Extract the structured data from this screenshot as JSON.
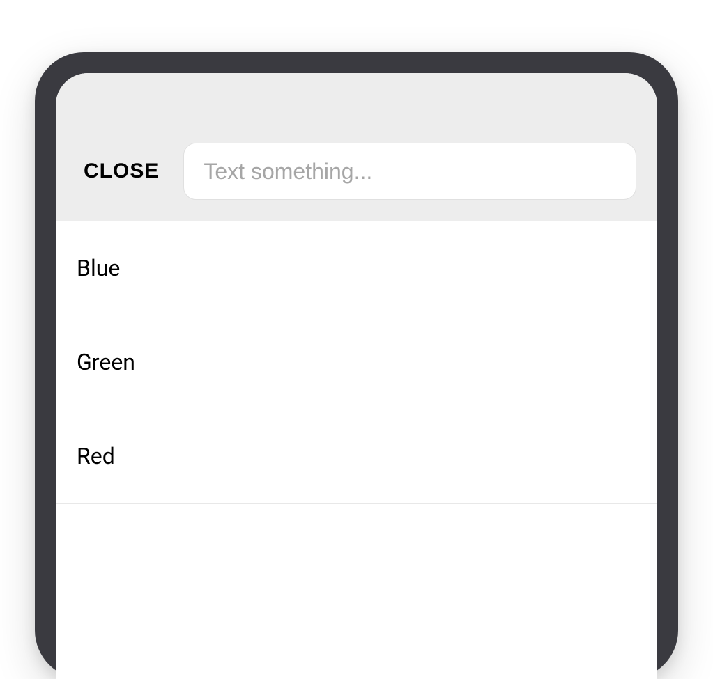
{
  "header": {
    "close_label": "CLOSE",
    "search_placeholder": "Text something...",
    "search_value": ""
  },
  "list": {
    "items": [
      {
        "label": "Blue"
      },
      {
        "label": "Green"
      },
      {
        "label": "Red"
      }
    ]
  }
}
